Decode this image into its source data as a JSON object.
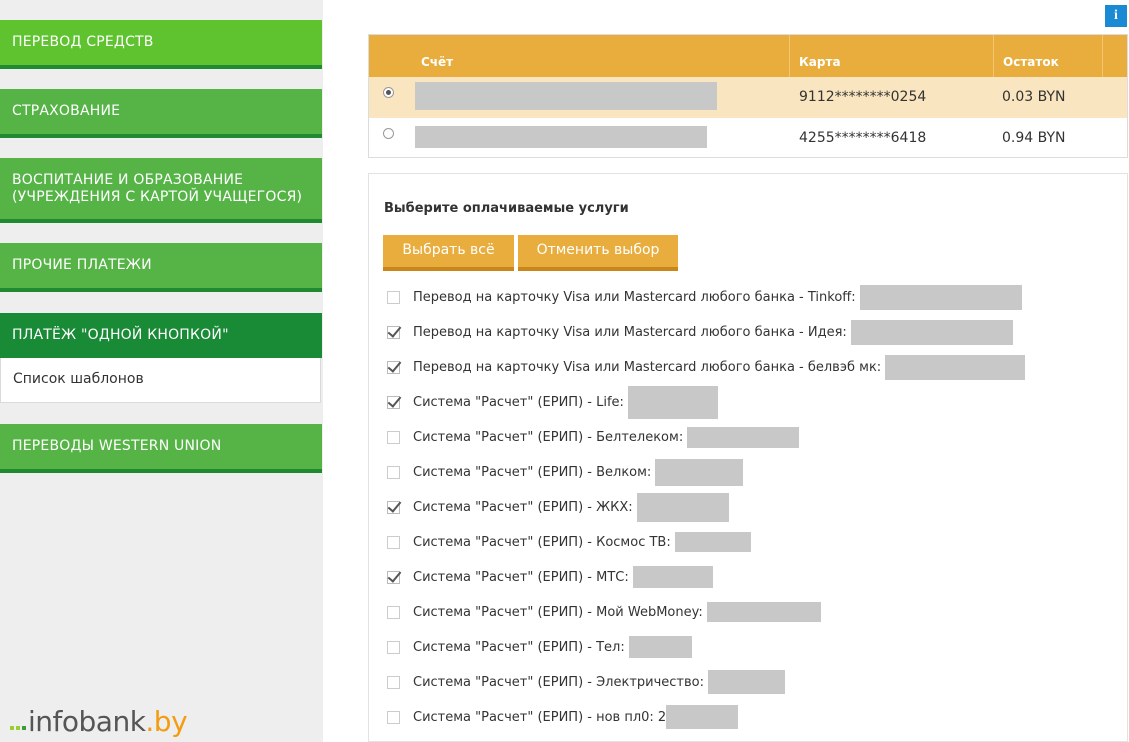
{
  "sidebar": {
    "items": [
      {
        "label": "ПЕРЕВОД СРЕДСТВ"
      },
      {
        "label": "СТРАХОВАНИЕ"
      },
      {
        "label": "ВОСПИТАНИЕ И ОБРАЗОВАНИЕ (УЧРЕЖДЕНИЯ С КАРТОЙ УЧАЩЕГОСЯ)"
      },
      {
        "label": "ПРОЧИЕ ПЛАТЕЖИ"
      },
      {
        "label": "ПЛАТЁЖ \"ОДНОЙ КНОПКОЙ\""
      },
      {
        "label": "ПЕРЕВОДЫ WESTERN UNION"
      }
    ],
    "submenu_item": "Список шаблонов"
  },
  "watermark": {
    "brand": "infobank",
    "tld": ".by"
  },
  "info_button": "i",
  "accounts": {
    "headers": {
      "account": "Счёт",
      "card": "Карта",
      "balance": "Остаток"
    },
    "rows": [
      {
        "card": "9112********0254",
        "balance": "0.03 BYN",
        "selected": true
      },
      {
        "card": "4255********6418",
        "balance": "0.94 BYN",
        "selected": false
      }
    ]
  },
  "services": {
    "title": "Выберите оплачиваемые услуги",
    "select_all": "Выбрать всё",
    "cancel_selection": "Отменить выбор",
    "items": [
      {
        "label": "Перевод на карточку Visa или Mastercard любого банка - Tinkoff:",
        "checked": false
      },
      {
        "label": "Перевод на карточку Visa или Mastercard любого банка - Идея:",
        "checked": true
      },
      {
        "label": "Перевод на карточку Visa или Mastercard любого банка - белвэб мк:",
        "checked": true
      },
      {
        "label": "Система \"Расчет\" (ЕРИП) - Life:",
        "checked": true
      },
      {
        "label": "Система \"Расчет\" (ЕРИП) - Белтелеком:",
        "checked": false
      },
      {
        "label": "Система \"Расчет\" (ЕРИП) - Велком:",
        "checked": false
      },
      {
        "label": "Система \"Расчет\" (ЕРИП) - ЖКХ:",
        "checked": true
      },
      {
        "label": "Система \"Расчет\" (ЕРИП) - Космос ТВ:",
        "checked": false
      },
      {
        "label": "Система \"Расчет\" (ЕРИП) - МТС:",
        "checked": true
      },
      {
        "label": "Система \"Расчет\" (ЕРИП) - Мой WebMoney:",
        "checked": false
      },
      {
        "label": "Система \"Расчет\" (ЕРИП) - Тел:",
        "checked": false
      },
      {
        "label": "Система \"Расчет\" (ЕРИП) - Электричество:",
        "checked": false
      },
      {
        "label": "Система \"Расчет\" (ЕРИП) - нов пл0: 2",
        "checked": false
      }
    ]
  }
}
